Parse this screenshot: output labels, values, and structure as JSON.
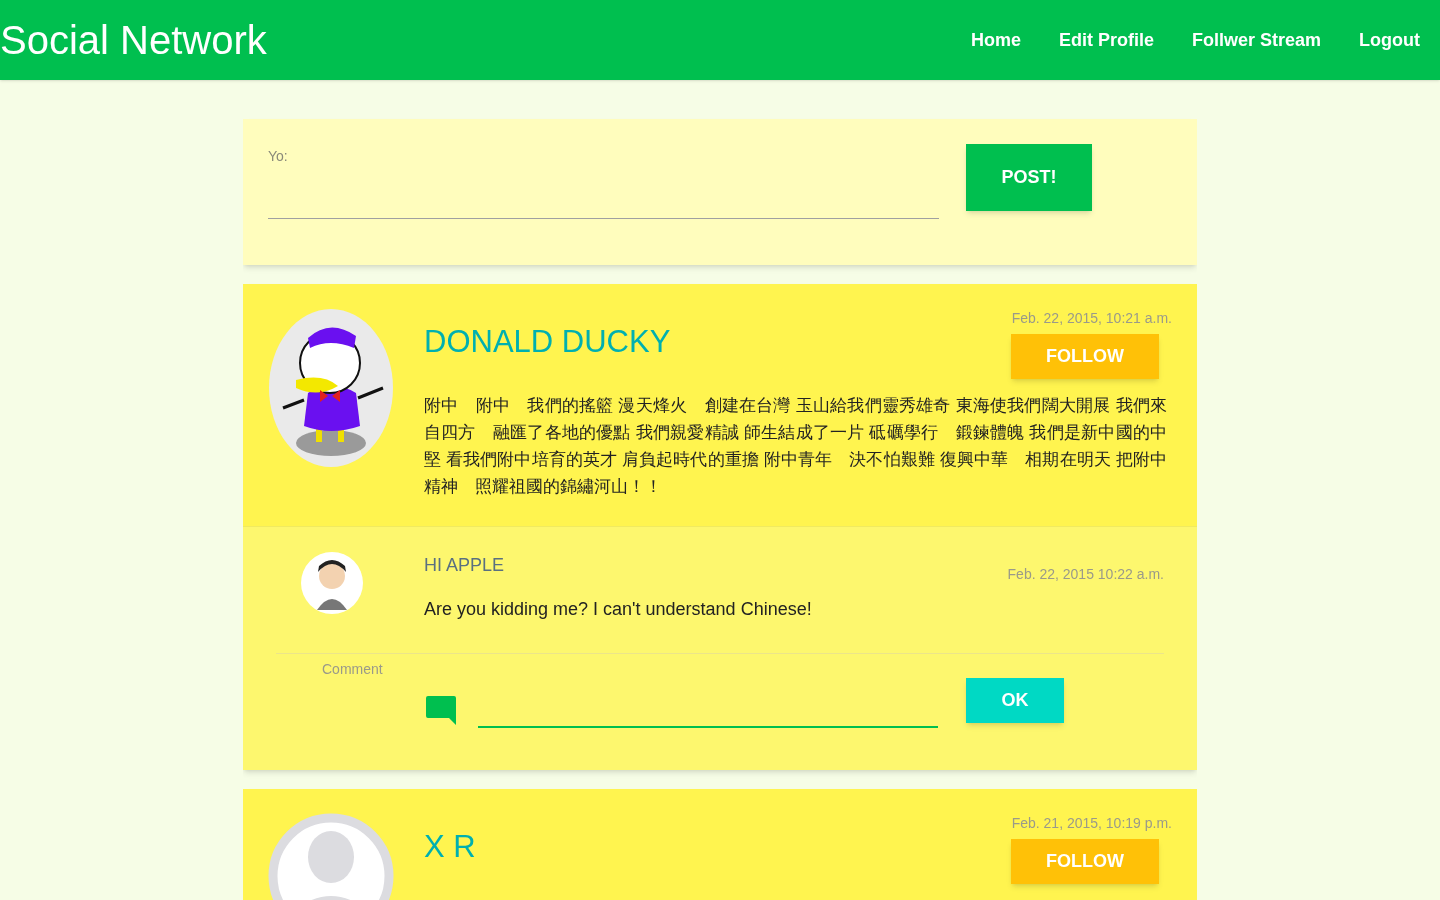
{
  "nav": {
    "brand": "Social Network",
    "links": [
      "Home",
      "Edit Profile",
      "Follwer Stream",
      "Logout"
    ]
  },
  "composer": {
    "label": "Yo:",
    "button": "POST!"
  },
  "posts": [
    {
      "avatar": {
        "kind": "picture"
      },
      "author": "DONALD DUCKY",
      "date": "Feb. 22, 2015, 10:21 a.m.",
      "follow": "FOLLOW",
      "body": "附中　附中　我們的搖籃 漫天烽火　創建在台灣 玉山給我們靈秀雄奇 東海使我們闊大開展 我們來自四方　融匯了各地的優點 我們親愛精誠 師生結成了一片 砥礪學行　鍛鍊體魄 我們是新中國的中堅 看我們附中培育的英才 肩負起時代的重擔 附中青年　決不怕艱難 復興中華　相期在明天 把附中精神　照耀祖國的錦繡河山！！",
      "comments": [
        {
          "author": "HI APPLE",
          "date": "Feb. 22, 2015 10:22 a.m.",
          "text": "Are you kidding me? I can't understand Chinese!"
        }
      ],
      "comment_form": {
        "label": "Comment",
        "button": "OK"
      }
    },
    {
      "avatar": {
        "kind": "placeholder"
      },
      "author": "X R",
      "date": "Feb. 21, 2015, 10:19 p.m.",
      "follow": "FOLLOW"
    }
  ]
}
